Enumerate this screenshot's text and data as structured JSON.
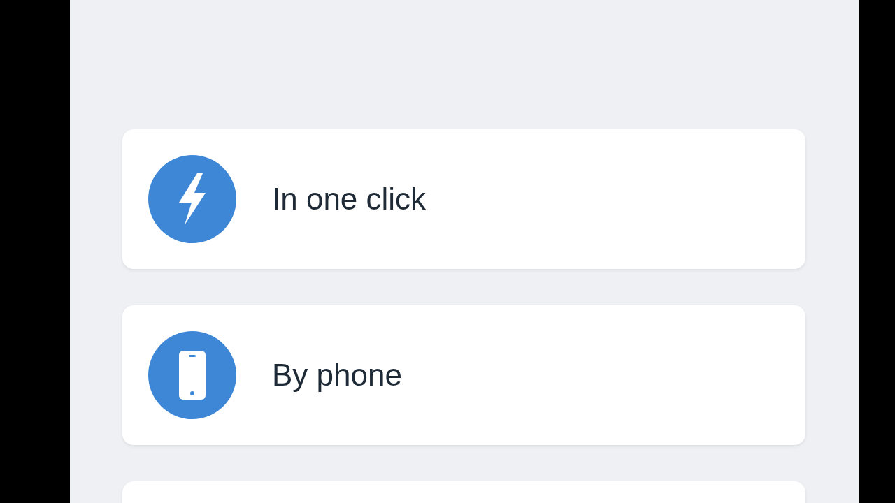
{
  "options": [
    {
      "kind": "bolt",
      "label": "In one click"
    },
    {
      "kind": "phone",
      "label": "By phone"
    }
  ]
}
